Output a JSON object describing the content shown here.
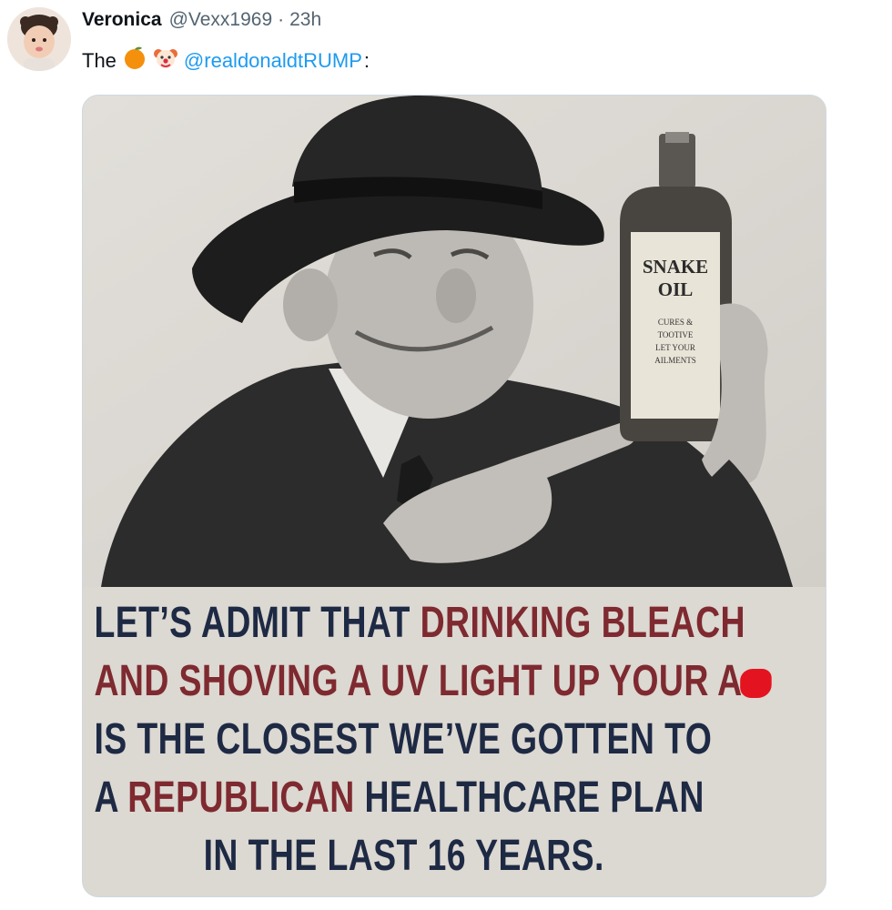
{
  "tweet": {
    "author_name": "Veronica",
    "author_handle": "@Vexx1969",
    "separator": "·",
    "time_ago": "23h",
    "text_prefix": "The",
    "emojis": [
      "orange-emoji",
      "clown-emoji"
    ],
    "mention": "@realdonaldtRUMP",
    "text_suffix": ":"
  },
  "image": {
    "bottle_label_title_1": "SNAKE",
    "bottle_label_title_2": "OIL",
    "bottle_label_small": [
      "CURES &",
      "TOOTIVE",
      "LET YOUR",
      "AILMENTS"
    ],
    "caption_lines": [
      [
        {
          "text": "LET’S ADMIT THAT ",
          "color": "navy"
        },
        {
          "text": "DRINKING BLEACH",
          "color": "red"
        }
      ],
      [
        {
          "text": "AND SHOVING A UV LIGHT UP YOUR A",
          "color": "red"
        }
      ],
      [
        {
          "text": "IS THE CLOSEST WE’VE GOTTEN TO",
          "color": "navy"
        }
      ],
      [
        {
          "text": "A ",
          "color": "navy"
        },
        {
          "text": "REPUBLICAN",
          "color": "red"
        },
        {
          "text": " HEALTHCARE PLAN",
          "color": "navy"
        }
      ],
      [
        {
          "text": "IN THE LAST 16 YEARS.",
          "color": "navy"
        }
      ]
    ]
  },
  "colors": {
    "mention": "#1d9bf0",
    "caption_navy": "#1e2a44",
    "caption_red": "#7e2a30",
    "redaction": "#e3141f"
  }
}
